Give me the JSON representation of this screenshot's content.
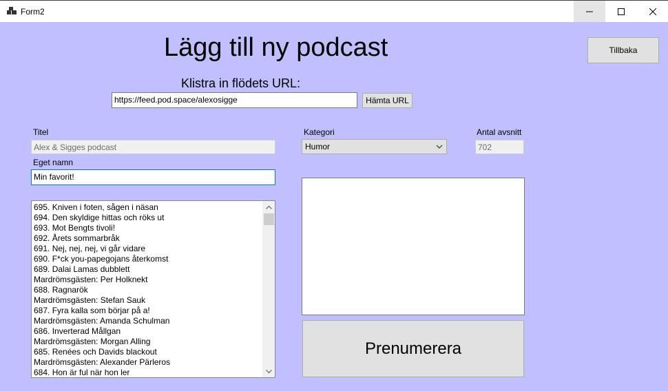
{
  "window": {
    "title": "Form2"
  },
  "header": {
    "title": "Lägg till ny podcast"
  },
  "url_section": {
    "label": "Klistra in flödets URL:",
    "url_value": "https://feed.pod.space/alexosigge",
    "fetch_button": "Hämta URL"
  },
  "back_button": "Tillbaka",
  "fields": {
    "title_label": "Titel",
    "title_value": "Alex & Sigges podcast",
    "own_name_label": "Eget namn",
    "own_name_value": "Min favorit!",
    "category_label": "Kategori",
    "category_value": "Humor",
    "episodes_label": "Antal avsnitt",
    "episodes_value": "702"
  },
  "episodes": [
    "695. Kniven i foten, sågen i näsan",
    "694. Den skyldige hittas och röks ut",
    "693. Mot Bengts tivoli!",
    "692. Årets sommarbråk",
    "691. Nej, nej, nej, vi går vidare",
    "690. F*ck you-papegojans återkomst",
    "689. Dalai Lamas dubblett",
    "Mardrömsgästen: Per Holknekt",
    "688. Ragnarök",
    "Mardrömsgästen: Stefan Sauk",
    "687. Fyra kalla som börjar på a!",
    "Mardrömsgästen: Amanda Schulman",
    "686. Inverterad Mållgan",
    "Mardrömsgästen: Morgan Alling",
    "685. Renées och Davids blackout",
    "Mardrömsgästen: Alexander Pärleros",
    "684. Hon är ful när hon ler"
  ],
  "subscribe_button": "Prenumerera",
  "icons": {
    "app": "app-icon",
    "minimize": "minimize-icon",
    "maximize": "maximize-icon",
    "close": "close-icon",
    "dropdown": "chevron-down-icon",
    "scroll_up": "scroll-up-arrow-icon",
    "scroll_down": "scroll-down-arrow-icon"
  },
  "colors": {
    "form_background": "#c0c0ff",
    "focus_border": "#0078d7"
  }
}
